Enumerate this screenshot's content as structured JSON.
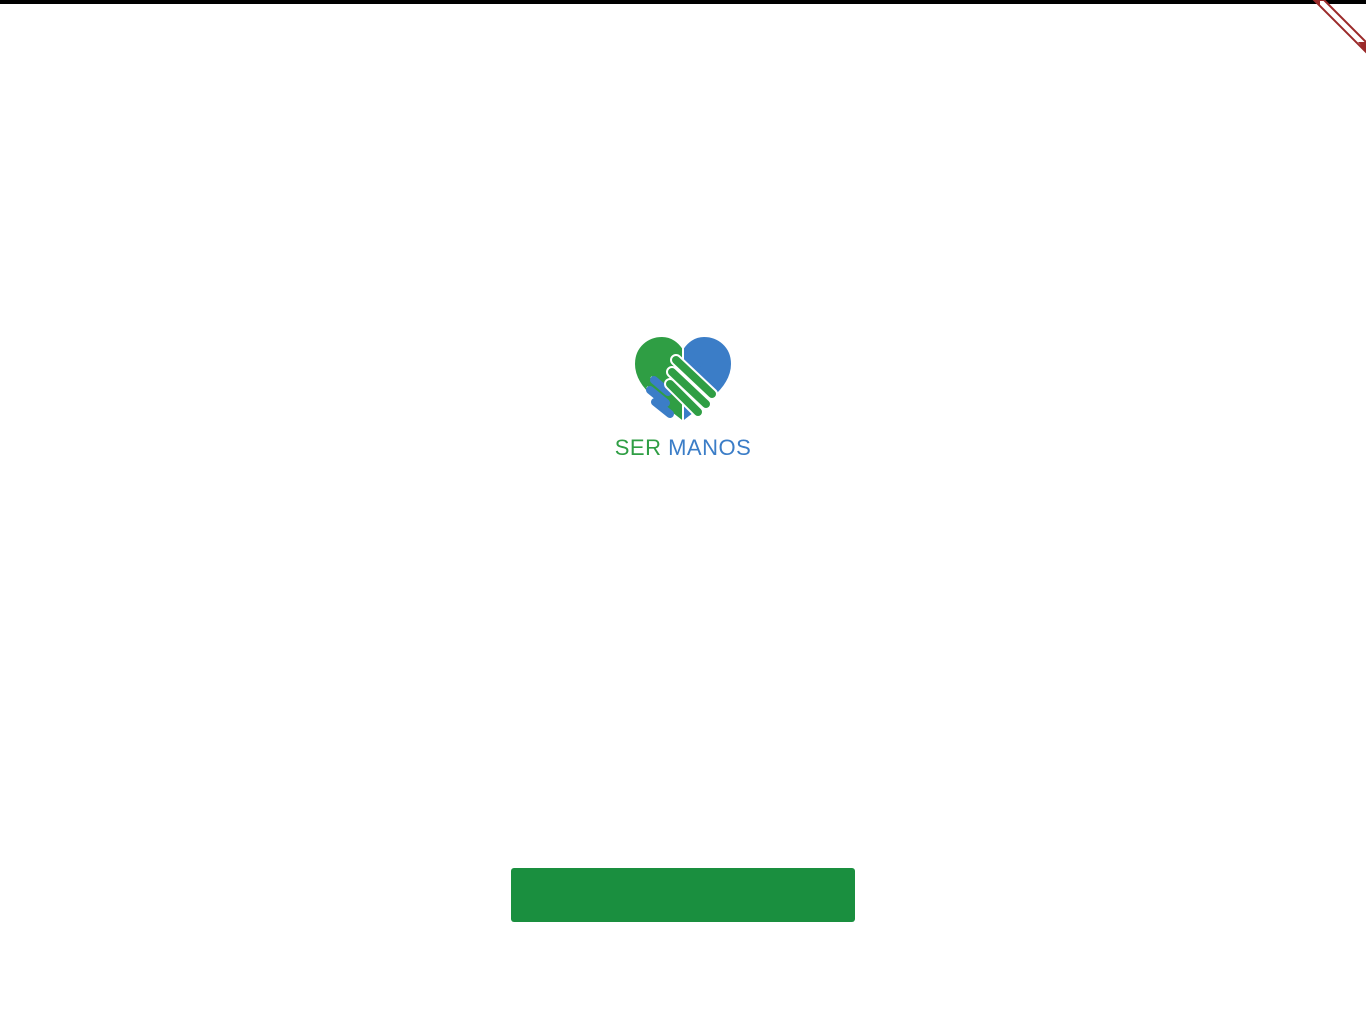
{
  "brand": {
    "name_part1": "SER",
    "name_part2": "MANOS",
    "green": "#2f9e44",
    "blue": "#3b7dc7",
    "logo_icon": "heart-handshake-icon"
  },
  "main": {
    "message": "",
    "cta_label": "",
    "secondary_label": ""
  },
  "colors": {
    "button_bg": "#1a8f3f",
    "top_bar": "#000000",
    "ribbon": "#9b2a2a"
  }
}
